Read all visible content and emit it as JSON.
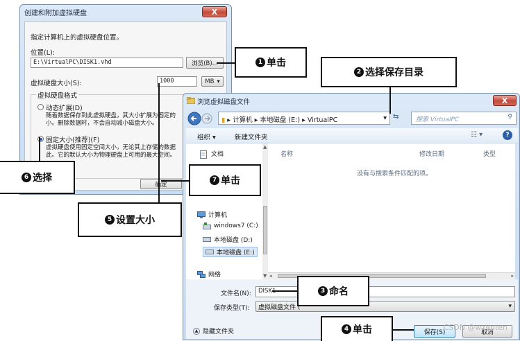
{
  "dialog1": {
    "title": "创建和附加虚拟硬盘",
    "close": "X",
    "instruction": "指定计算机上的虚拟硬盘位置。",
    "location_label": "位置(L):",
    "location_value": "E:\\VirtualPC\\DISK1.vhd",
    "browse_button": "浏览(B)...",
    "size_label": "虚拟硬盘大小(S):",
    "size_value": "1000",
    "size_unit": "MB",
    "format_label": "虚拟硬盘格式",
    "dynamic_label": "动态扩展(D)",
    "dynamic_desc1": "随着数据保存到此虚拟硬盘，其大小扩展为固定的",
    "dynamic_desc2": "小。删除数据时，不会自动减小磁盘大小。",
    "fixed_label": "固定大小(推荐)(F)",
    "fixed_desc1": "虚拟硬盘使用固定空间大小，无论其上存储的数据",
    "fixed_desc2": "此。它的默认大小为物理硬盘上可用的最大空间。",
    "ok_button": "确定"
  },
  "dialog2": {
    "title": "浏览虚拟磁盘文件",
    "close": "X",
    "breadcrumb": [
      "计算机",
      "本地磁盘 (E:)",
      "VirtualPC"
    ],
    "search_placeholder": "搜索 VirtualPC",
    "organize": "组织 ▾",
    "new_folder": "新建文件夹",
    "nav_top": "文档",
    "nav_computer": "计算机",
    "nav_drives": [
      "windows7 (C:)",
      "本地磁盘 (D:)",
      "本地磁盘 (E:)"
    ],
    "nav_network": "网络",
    "columns": [
      "名称",
      "修改日期",
      "类型"
    ],
    "empty_message": "没有与搜索条件匹配的项。",
    "filename_label": "文件名(N):",
    "filename_value": "DISK1",
    "filetype_label": "保存类型(T):",
    "filetype_value": "虚拟磁盘文件 (",
    "hide_folders": "隐藏文件夹",
    "save_button": "保存(S)",
    "cancel_button": "取消"
  },
  "callouts": {
    "c1": "单击",
    "c2": "选择保存目录",
    "c3": "命名",
    "c4": "单击",
    "c5": "设置大小",
    "c6": "选择",
    "c7": "单击"
  },
  "callout_nums": {
    "c1": "1",
    "c2": "2",
    "c3": "3",
    "c4": "4",
    "c5": "5",
    "c6": "6",
    "c7": "7"
  },
  "watermark": "CSDN @wzepten"
}
